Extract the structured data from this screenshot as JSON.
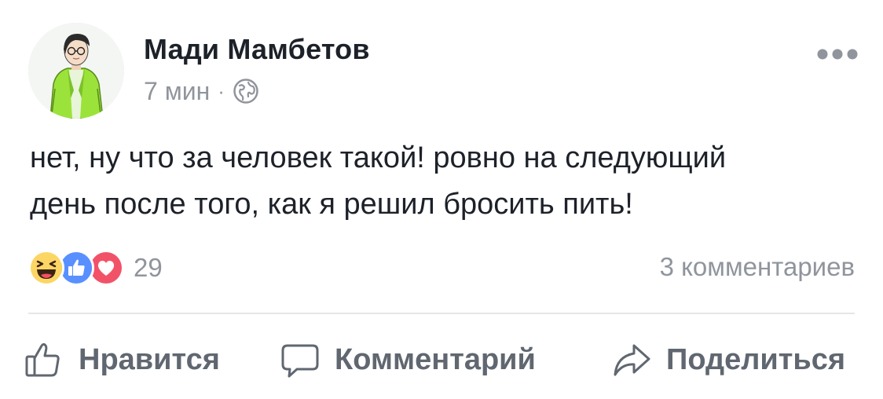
{
  "post": {
    "author_name": "Мади Мамбетов",
    "time": "7 мин",
    "separator": "·",
    "privacy_icon": "globe-icon",
    "more_icon": "ellipsis-icon",
    "text": "нет, ну что за человек такой! ровно на следующий\nдень после того, как я решил бросить пить!"
  },
  "reactions": {
    "icons": [
      "haha-icon",
      "like-reaction-icon",
      "love-icon"
    ],
    "count": "29",
    "comments_label": "3 комментариев"
  },
  "actions": {
    "like_label": "Нравится",
    "comment_label": "Комментарий",
    "share_label": "Поделиться"
  },
  "colors": {
    "text": "#1d2129",
    "secondary": "#90949c",
    "action": "#606770",
    "like_blue": "#5890ff",
    "love_red": "#f25268",
    "haha_yellow": "#fcd664",
    "avatar_jacket": "#9be33a"
  }
}
